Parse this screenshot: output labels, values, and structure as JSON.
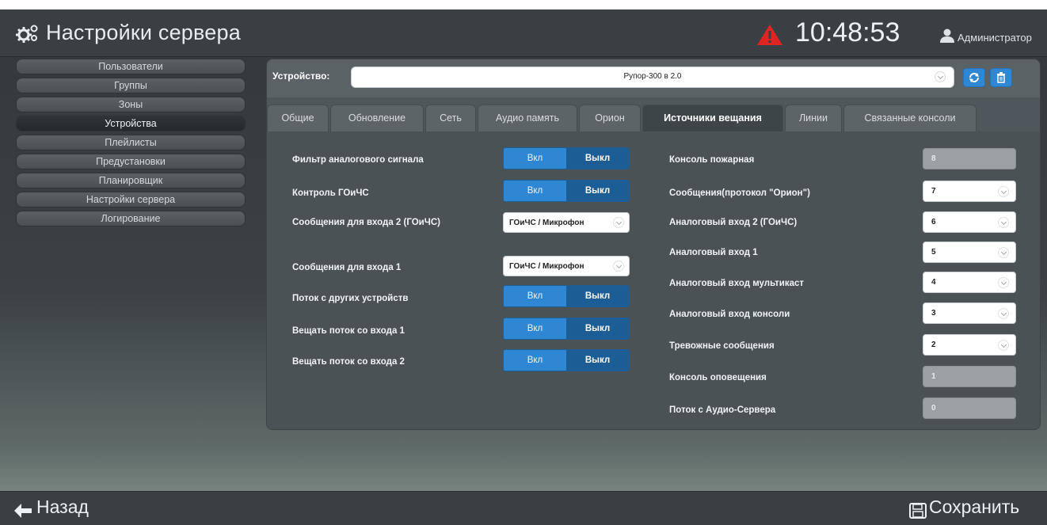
{
  "header": {
    "title": "Настройки сервера",
    "clock": "10:48:53",
    "user": "Администратор",
    "icons": [
      "cogs-icon",
      "alert-icon",
      "user-icon"
    ],
    "alert_color": "#e02424"
  },
  "sidebar": {
    "items": [
      {
        "label": "Пользователи"
      },
      {
        "label": "Группы"
      },
      {
        "label": "Зоны"
      },
      {
        "label": "Устройства",
        "active": true
      },
      {
        "label": "Плейлисты"
      },
      {
        "label": "Предустановки"
      },
      {
        "label": "Планировщик"
      },
      {
        "label": "Настройки сервера"
      },
      {
        "label": "Логирование"
      }
    ]
  },
  "device": {
    "label": "Устройство:",
    "selected": "Рупор-300 в 2.0",
    "icons": [
      "refresh-icon",
      "trash-icon"
    ]
  },
  "tabs": [
    {
      "label": "Общие"
    },
    {
      "label": "Обновление"
    },
    {
      "label": "Сеть"
    },
    {
      "label": "Аудио память"
    },
    {
      "label": "Орион"
    },
    {
      "label": "Источники вещания",
      "active": true
    },
    {
      "label": "Линии"
    },
    {
      "label": "Связанные консоли"
    }
  ],
  "left_settings": [
    {
      "label": "Фильтр аналогового сигнала",
      "type": "toggle",
      "on": "Вкл",
      "off": "Выкл",
      "value": "Выкл"
    },
    {
      "label": "Контроль ГОиЧС",
      "type": "toggle",
      "on": "Вкл",
      "off": "Выкл",
      "value": "Выкл"
    },
    {
      "label": "Сообщения для входа 2 (ГОиЧС)",
      "type": "select",
      "value": "ГОиЧС / Микрофон"
    },
    {
      "label": "Сообщения для входа 1",
      "type": "select",
      "value": "ГОиЧС / Микрофон"
    },
    {
      "label": "Поток с других устройств",
      "type": "toggle",
      "on": "Вкл",
      "off": "Выкл",
      "value": "Выкл"
    },
    {
      "label": "Вещать поток со входа 1",
      "type": "toggle",
      "on": "Вкл",
      "off": "Выкл",
      "value": "Выкл"
    },
    {
      "label": "Вещать поток со входа 2",
      "type": "toggle",
      "on": "Вкл",
      "off": "Выкл",
      "value": "Выкл"
    }
  ],
  "right_settings": [
    {
      "label": "Консоль пожарная",
      "value": "8",
      "disabled": true
    },
    {
      "label": "Сообщения(протокол \"Орион\")",
      "value": "7",
      "disabled": false
    },
    {
      "label": "Аналоговый вход 2 (ГОиЧС)",
      "value": "6",
      "disabled": false
    },
    {
      "label": "Аналоговый вход 1",
      "value": "5",
      "disabled": false
    },
    {
      "label": "Аналоговый вход мультикаст",
      "value": "4",
      "disabled": false
    },
    {
      "label": "Аналоговый вход консоли",
      "value": "3",
      "disabled": false
    },
    {
      "label": "Тревожные сообщения",
      "value": "2",
      "disabled": false
    },
    {
      "label": "Консоль оповещения",
      "value": "1",
      "disabled": true
    },
    {
      "label": "Поток с Аудио-Сервера",
      "value": "0",
      "disabled": true
    }
  ],
  "footer": {
    "back_label": "Назад",
    "save_label": "Сохранить",
    "icons": [
      "arrow-left-icon",
      "save-icon"
    ]
  }
}
